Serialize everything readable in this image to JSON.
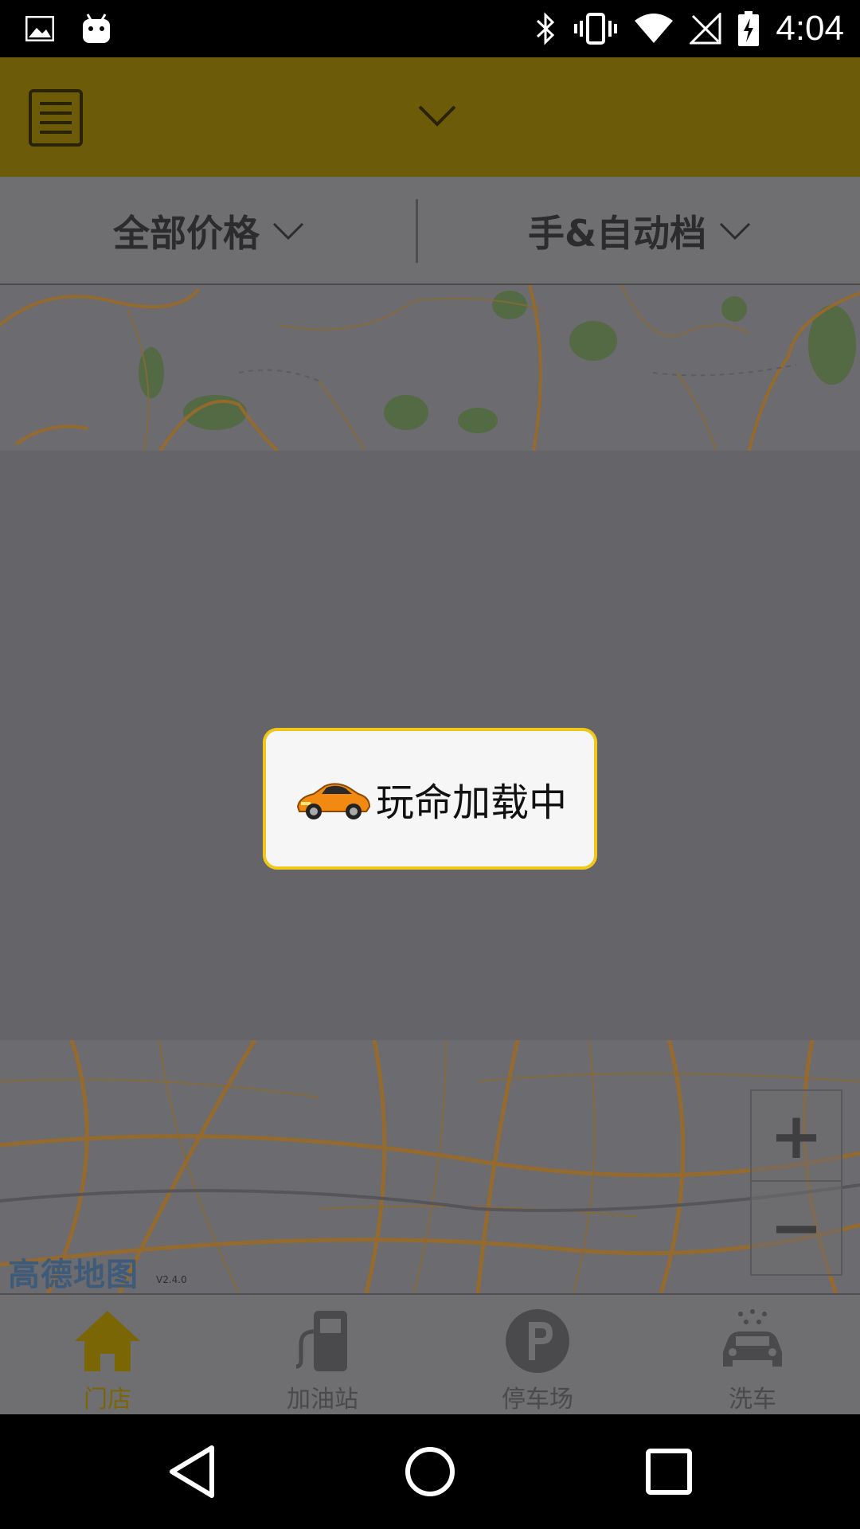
{
  "status_bar": {
    "time": "4:04",
    "icons": [
      "image-icon",
      "android-icon",
      "bluetooth-icon",
      "vibrate-icon",
      "wifi-icon",
      "no-signal-icon",
      "battery-charging-icon"
    ]
  },
  "header": {
    "menu_icon": "menu-list-icon",
    "dropdown_icon": "chevron-down-icon"
  },
  "filters": {
    "price": "全部价格",
    "transmission": "手&自动档"
  },
  "map": {
    "logo": "高德地图",
    "version": "V2.4.0",
    "zoom_in": "+",
    "zoom_out": "−"
  },
  "loading": {
    "text": "玩命加载中",
    "icon": "sports-car-icon"
  },
  "bottom_nav": {
    "items": [
      {
        "label": "门店",
        "icon": "home-icon",
        "active": true
      },
      {
        "label": "加油站",
        "icon": "gas-station-icon",
        "active": false
      },
      {
        "label": "停车场",
        "icon": "parking-icon",
        "active": false
      },
      {
        "label": "洗车",
        "icon": "car-wash-icon",
        "active": false
      }
    ]
  },
  "colors": {
    "header_bg": "#6c5b08",
    "accent": "#f0c81a",
    "active_nav": "#7b6606",
    "overlay": "#656469"
  }
}
